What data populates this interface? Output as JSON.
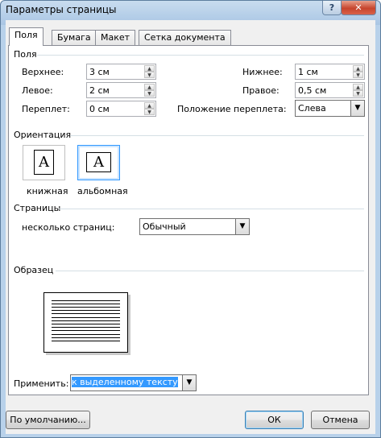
{
  "window": {
    "title": "Параметры страницы"
  },
  "title_buttons": {
    "help": "?",
    "close": "✕"
  },
  "tabs": [
    {
      "label": "Поля"
    },
    {
      "label": "Бумага"
    },
    {
      "label": "Макет"
    },
    {
      "label": "Сетка документа"
    }
  ],
  "margins": {
    "group_label": "Поля",
    "top": {
      "label": "Верхнее:",
      "value": "3 см"
    },
    "bottom": {
      "label": "Нижнее:",
      "value": "1 см"
    },
    "left": {
      "label": "Левое:",
      "value": "2 см"
    },
    "right": {
      "label": "Правое:",
      "value": "0,5 см"
    },
    "gutter": {
      "label": "Переплет:",
      "value": "0 см"
    },
    "gutter_pos": {
      "label": "Положение переплета:",
      "value": "Слева"
    }
  },
  "orientation": {
    "group_label": "Ориентация",
    "portrait": "книжная",
    "landscape": "альбомная",
    "selected": "landscape",
    "icon_glyph": "A"
  },
  "pages": {
    "group_label": "Страницы",
    "multiple_label": "несколько страниц:",
    "multiple_value": "Обычный"
  },
  "preview": {
    "group_label": "Образец"
  },
  "apply": {
    "label": "Применить:",
    "value": "к выделенному тексту"
  },
  "buttons": {
    "default": "По умолчанию...",
    "ok": "ОК",
    "cancel": "Отмена"
  },
  "glyphs": {
    "up": "▲",
    "down": "▼"
  }
}
